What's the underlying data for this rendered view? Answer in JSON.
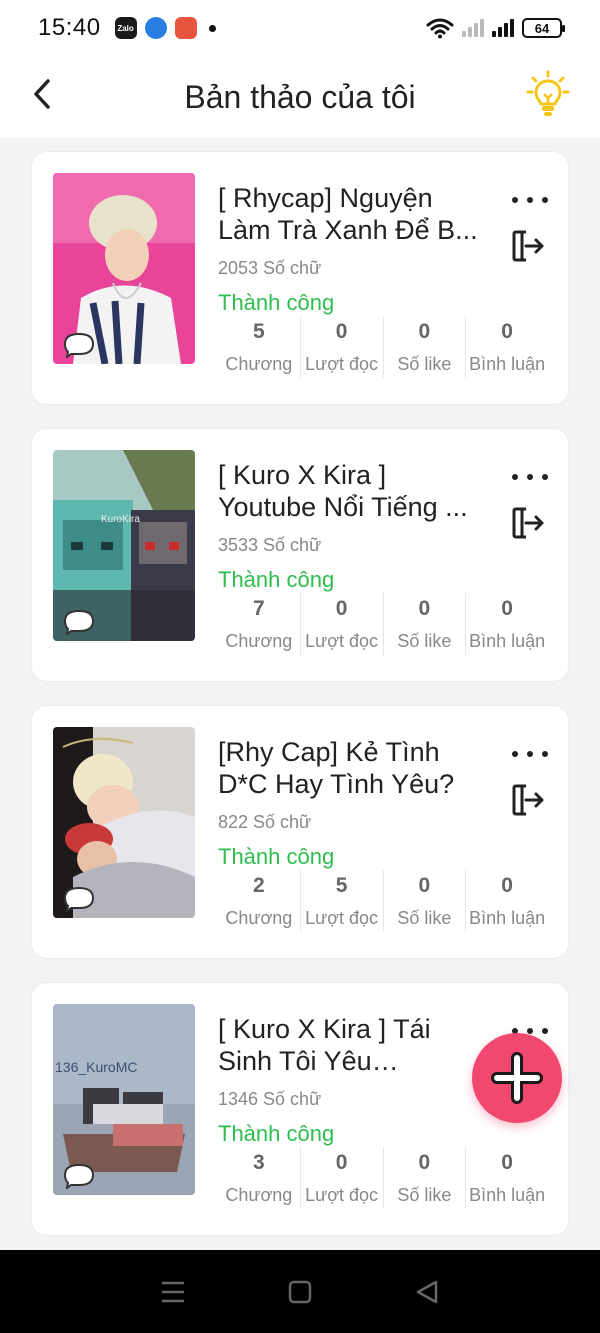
{
  "status_bar": {
    "time": "15:40",
    "apps": [
      {
        "name": "zalo-icon",
        "label": "Zalo"
      },
      {
        "name": "messenger-icon",
        "label": ""
      },
      {
        "name": "game-icon",
        "label": ""
      }
    ],
    "battery": "64"
  },
  "header": {
    "title": "Bản thảo của tôi"
  },
  "drafts": [
    {
      "title": "[ Rhycap] Nguyện Làm Trà Xanh Để B...",
      "words": "2053 Số chữ",
      "status": "Thành công",
      "stats": [
        {
          "value": "5",
          "label": "Chương"
        },
        {
          "value": "0",
          "label": "Lượt đọc"
        },
        {
          "value": "0",
          "label": "Số like"
        },
        {
          "value": "0",
          "label": "Bình luận"
        }
      ],
      "thumb_colors": [
        "#e8449a",
        "#f0c8d8"
      ]
    },
    {
      "title": "[ Kuro X Kira ] Youtube Nổi Tiếng ...",
      "words": "3533 Số chữ",
      "status": "Thành công",
      "stats": [
        {
          "value": "7",
          "label": "Chương"
        },
        {
          "value": "0",
          "label": "Lượt đọc"
        },
        {
          "value": "0",
          "label": "Số like"
        },
        {
          "value": "0",
          "label": "Bình luận"
        }
      ],
      "thumb_colors": [
        "#5fb8b0",
        "#3a3a4a"
      ]
    },
    {
      "title": "[Rhy Cap] Kẻ Tình D*C Hay Tình Yêu?",
      "words": "822 Số chữ",
      "status": "Thành công",
      "stats": [
        {
          "value": "2",
          "label": "Chương"
        },
        {
          "value": "5",
          "label": "Lượt đọc"
        },
        {
          "value": "0",
          "label": "Số like"
        },
        {
          "value": "0",
          "label": "Bình luận"
        }
      ],
      "thumb_colors": [
        "#e0d8d0",
        "#c84040"
      ]
    },
    {
      "title": "[ Kuro X Kira ] Tái Sinh Tôi Yêu Thươn...",
      "words": "1346 Số chữ",
      "status": "Thành công",
      "stats": [
        {
          "value": "3",
          "label": "Chương"
        },
        {
          "value": "0",
          "label": "Lượt đọc"
        },
        {
          "value": "0",
          "label": "Số like"
        },
        {
          "value": "0",
          "label": "Bình luận"
        }
      ],
      "thumb_colors": [
        "#aab8c8",
        "#7a5a50"
      ]
    }
  ],
  "thumb_texts": {
    "kurakira": "KuroKira",
    "kuromc": "136_KuroMC"
  },
  "colors": {
    "accent_pink": "#f0486e",
    "success_green": "#2ebd4f",
    "bulb_yellow": "#f5c518"
  }
}
